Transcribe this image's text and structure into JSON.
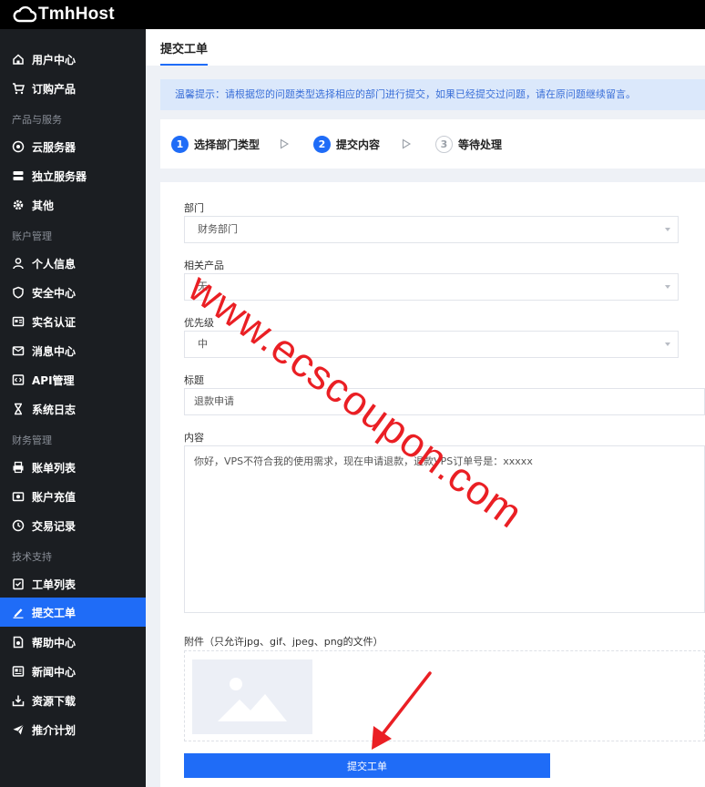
{
  "brand": {
    "name": "TmhHost"
  },
  "sidebar": {
    "items": [
      {
        "label": "用户中心",
        "icon": "home-icon"
      },
      {
        "label": "订购产品",
        "icon": "cart-icon"
      },
      {
        "label": "云服务器",
        "icon": "cloud-server-icon"
      },
      {
        "label": "独立服务器",
        "icon": "dedicated-server-icon"
      },
      {
        "label": "其他",
        "icon": "gear-icon"
      },
      {
        "label": "个人信息",
        "icon": "user-icon"
      },
      {
        "label": "安全中心",
        "icon": "shield-icon"
      },
      {
        "label": "实名认证",
        "icon": "id-card-icon"
      },
      {
        "label": "消息中心",
        "icon": "message-icon"
      },
      {
        "label": "API管理",
        "icon": "api-icon"
      },
      {
        "label": "系统日志",
        "icon": "hourglass-icon"
      },
      {
        "label": "账单列表",
        "icon": "printer-icon"
      },
      {
        "label": "账户充值",
        "icon": "wallet-icon"
      },
      {
        "label": "交易记录",
        "icon": "clock-icon"
      },
      {
        "label": "工单列表",
        "icon": "checklist-icon"
      },
      {
        "label": "提交工单",
        "icon": "pen-icon"
      },
      {
        "label": "帮助中心",
        "icon": "help-doc-icon"
      },
      {
        "label": "新闻中心",
        "icon": "news-icon"
      },
      {
        "label": "资源下载",
        "icon": "download-icon"
      },
      {
        "label": "推介计划",
        "icon": "send-icon"
      }
    ],
    "sections": [
      "产品与服务",
      "账户管理",
      "财务管理",
      "技术支持"
    ],
    "active_label": "提交工单"
  },
  "page": {
    "title": "提交工单",
    "notice": "温馨提示：请根据您的问题类型选择相应的部门进行提交，如果已经提交过问题，请在原问题继续留言。"
  },
  "steps": [
    {
      "num": "1",
      "label": "选择部门类型",
      "state": "done"
    },
    {
      "num": "2",
      "label": "提交内容",
      "state": "current"
    },
    {
      "num": "3",
      "label": "等待处理",
      "state": "pending"
    }
  ],
  "form": {
    "department": {
      "label": "部门",
      "value": "财务部门"
    },
    "product": {
      "label": "相关产品",
      "value": "无"
    },
    "priority": {
      "label": "优先级",
      "value": "中"
    },
    "subject": {
      "label": "标题",
      "value": "退款申请"
    },
    "content": {
      "label": "内容",
      "value": "你好，VPS不符合我的使用需求，现在申请退款，退款VPS订单号是：xxxxx"
    },
    "attachment": {
      "label": "附件（只允许jpg、gif、jpeg、png的文件）"
    },
    "submit_label": "提交工单"
  },
  "watermark": {
    "text": "www.ecscoupon.com",
    "color": "#ea1f24"
  },
  "colors": {
    "accent": "#1f6cf7",
    "sidebar_bg": "#1b1e22",
    "topbar_bg": "#000000",
    "annotation": "#ea1f24"
  }
}
